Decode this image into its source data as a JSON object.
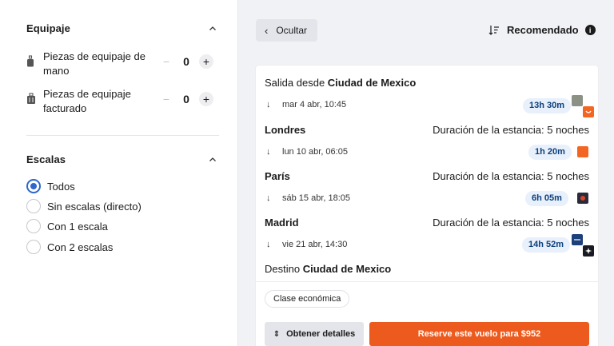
{
  "filters": {
    "luggage": {
      "title": "Equipaje",
      "items": [
        {
          "label": "Piezas de equipaje de mano",
          "value": "0",
          "icon": "carry-on-bag-icon"
        },
        {
          "label": "Piezas de equipaje facturado",
          "value": "0",
          "icon": "checked-bag-icon"
        }
      ]
    },
    "stops": {
      "title": "Escalas",
      "selected": "Todos",
      "options": [
        "Todos",
        "Sin escalas (directo)",
        "Con 1 escala",
        "Con 2 escalas"
      ]
    }
  },
  "toolbar": {
    "hide_label": "Ocultar",
    "sort_label": "Recomendado"
  },
  "itinerary": {
    "origin_prefix": "Salida desde",
    "origin_city": "Ciudad de Mexico",
    "destination_prefix": "Destino",
    "destination_city": "Ciudad de Mexico",
    "segments": [
      {
        "date": "mar 4 abr, 10:45",
        "duration": "13h 30m"
      },
      {
        "date": "lun 10 abr, 06:05",
        "duration": "1h 20m"
      },
      {
        "date": "sáb 15 abr, 18:05",
        "duration": "6h 05m"
      },
      {
        "date": "vie 21 abr, 14:30",
        "duration": "14h 52m"
      }
    ],
    "stays": [
      {
        "city": "Londres",
        "stay": "Duración de la estancia: 5 noches"
      },
      {
        "city": "París",
        "stay": "Duración de la estancia: 5 noches"
      },
      {
        "city": "Madrid",
        "stay": "Duración de la estancia: 5 noches"
      }
    ],
    "cabin_class": "Clase económica",
    "details_label": "Obtener detalles",
    "book_label": "Reserve este vuelo para $952"
  },
  "colors": {
    "accent": "#2f66cc",
    "book_button": "#ec5a1d",
    "duration_pill_bg": "#e7f0fb",
    "duration_pill_text": "#0d3f7a"
  }
}
